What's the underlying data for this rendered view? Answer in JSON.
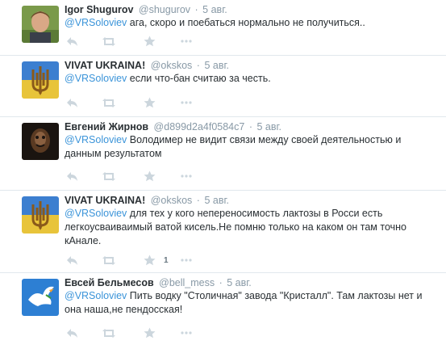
{
  "colors": {
    "mention": "#3b94d9",
    "muted": "#8899a6",
    "icon": "#ccd6dd",
    "divider": "#e1e8ed"
  },
  "tweets": [
    {
      "name": "Igor Shugurov",
      "handle": "@shugurov",
      "sep": "·",
      "time": "5 авг.",
      "mention": "@VRSoloviev",
      "text": " ага, скоро и поебаться нормально не получиться..",
      "avatar": "photo-avatar",
      "favorites": ""
    },
    {
      "name": "VIVAT UKRAINA!",
      "handle": "@okskos",
      "sep": "·",
      "time": "5 авг.",
      "mention": "@VRSoloviev",
      "text": " если что-бан считаю за честь.",
      "avatar": "trident-avatar",
      "favorites": ""
    },
    {
      "name": "Евгений Жирнов",
      "handle": "@d899d2a4f0584c7",
      "sep": "·",
      "time": "5 авг.",
      "mention": "@VRSoloviev",
      "text": " Володимер не видит связи между своей деятельностью и данным результатом",
      "avatar": "dark-figure-avatar",
      "favorites": ""
    },
    {
      "name": "VIVAT UKRAINA!",
      "handle": "@okskos",
      "sep": "·",
      "time": "5 авг.",
      "mention": "@VRSoloviev",
      "text": " для тех у кого непереносимость лактозы в Росси есть легкоусваиваимый ватой кисель.Не помню только на каком он там точно кАнале.",
      "avatar": "trident-avatar",
      "favorites": "1"
    },
    {
      "name": "Евсей Бельмесов",
      "handle": "@bell_mess",
      "sep": "·",
      "time": "5 авг.",
      "mention": "@VRSoloviev",
      "text": " Пить водку \"Столичная\" завода \"Кристалл\". Там лактозы нет и она наша,не пендосская!",
      "avatar": "dove-avatar",
      "favorites": ""
    }
  ]
}
